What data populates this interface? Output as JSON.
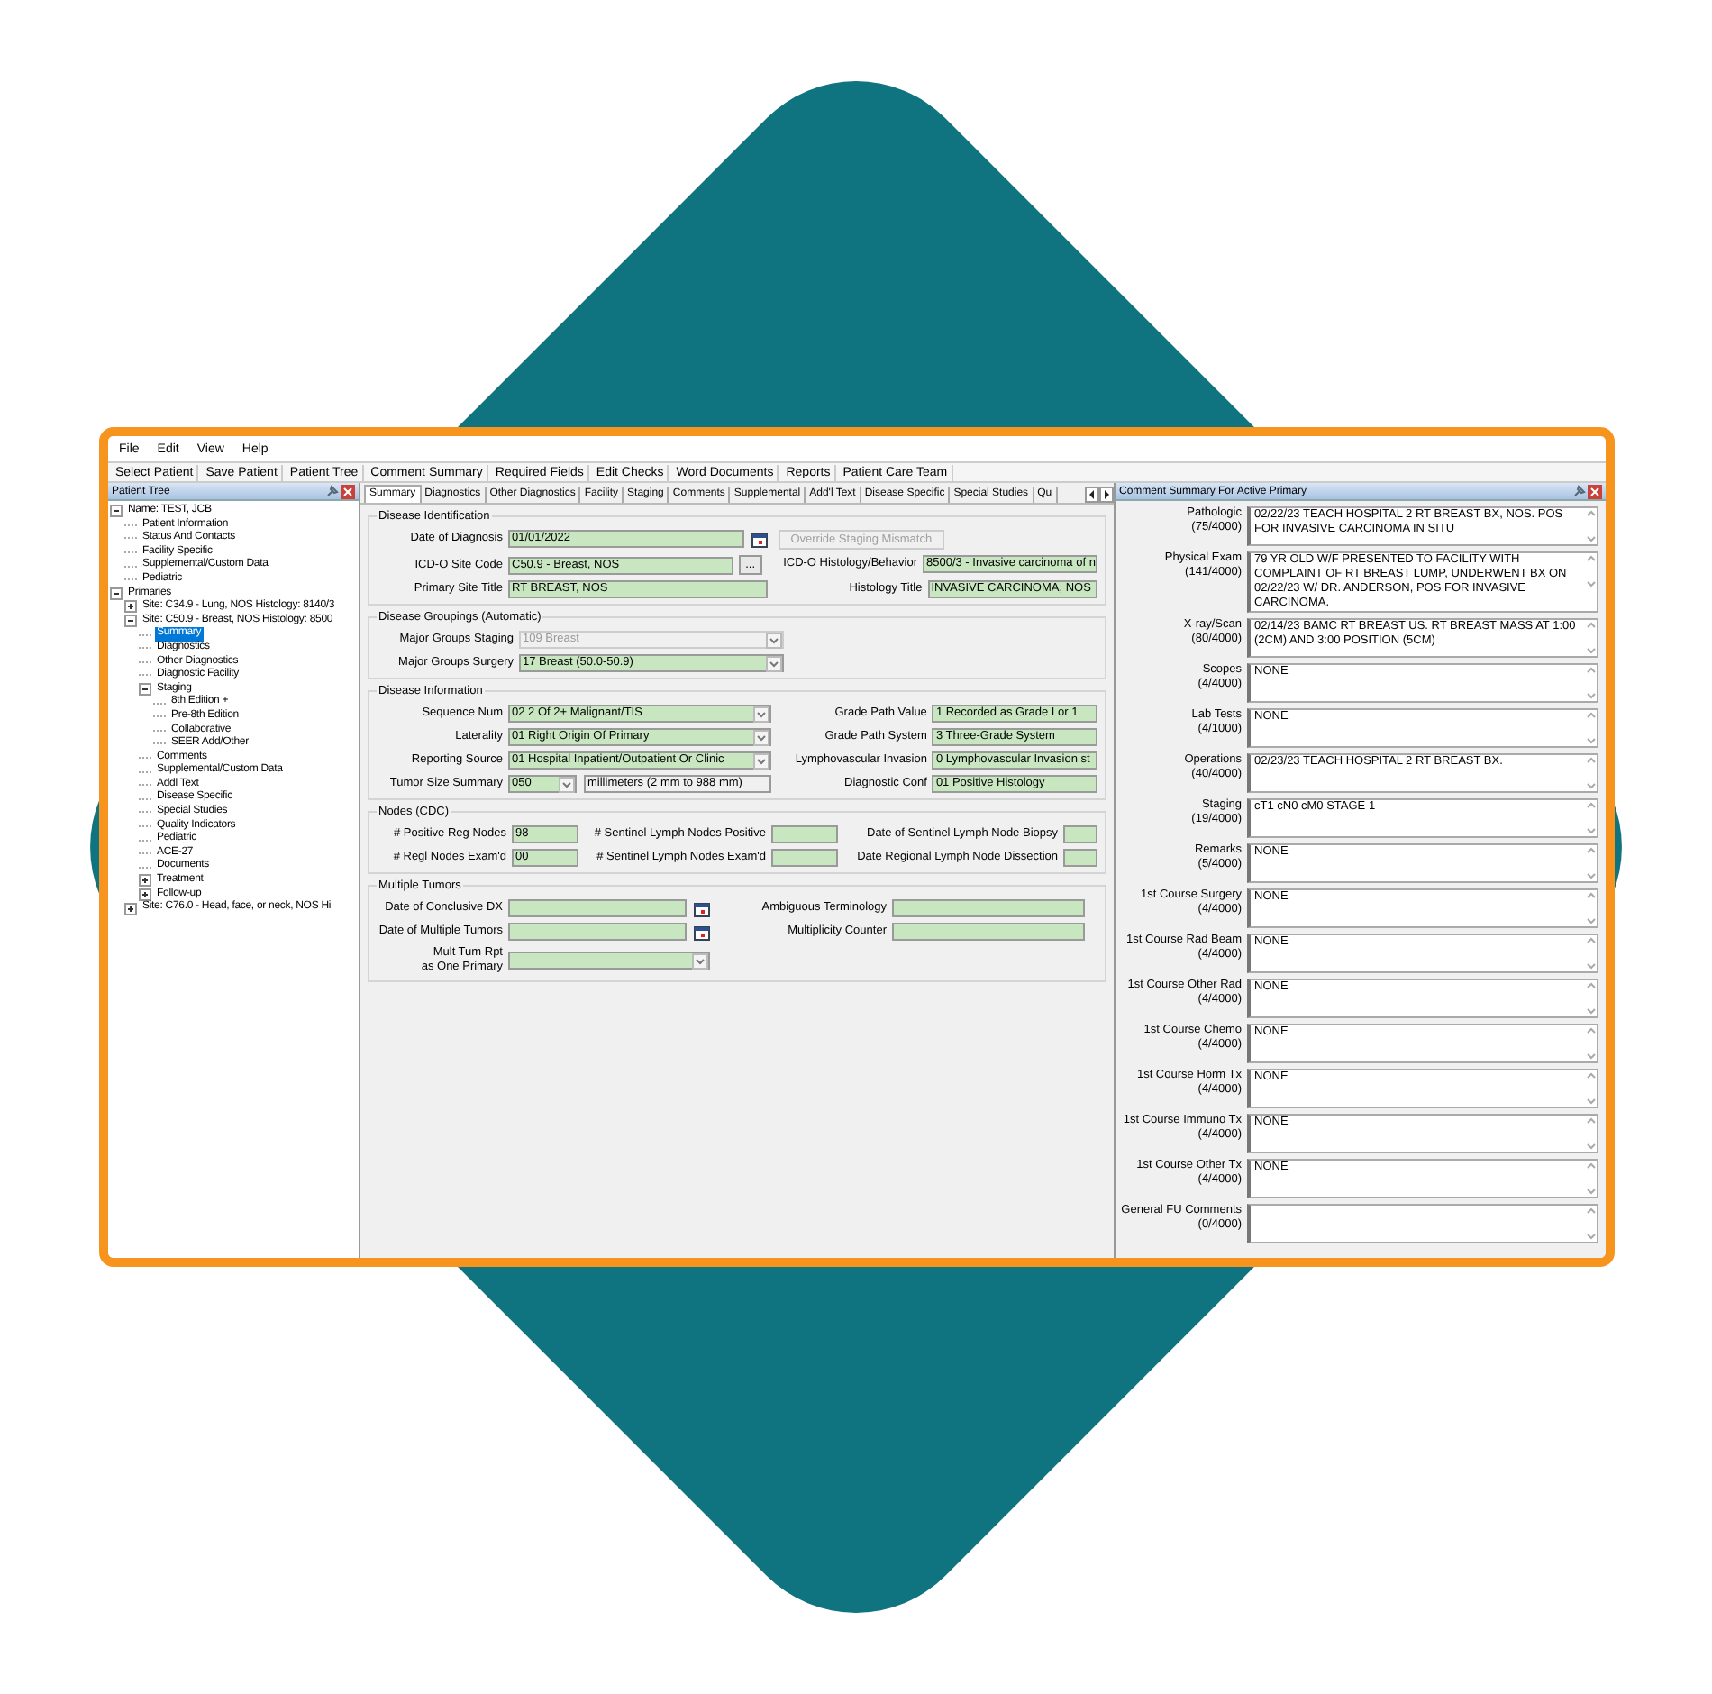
{
  "menu": [
    "File",
    "Edit",
    "View",
    "Help"
  ],
  "toolbar": [
    "Select Patient",
    "Save Patient",
    "Patient Tree",
    "Comment Summary",
    "Required Fields",
    "Edit Checks",
    "Word Documents",
    "Reports",
    "Patient Care Team"
  ],
  "tree": {
    "title": "Patient Tree",
    "nodes": [
      {
        "label": "Name: TEST, JCB",
        "kind": "branch",
        "expanded": true,
        "selected": false,
        "children": [
          {
            "label": "Patient Information",
            "kind": "leaf",
            "selected": false
          },
          {
            "label": "Status And Contacts",
            "kind": "leaf",
            "selected": false
          },
          {
            "label": "Facility Specific",
            "kind": "leaf",
            "selected": false
          },
          {
            "label": "Supplemental/Custom Data",
            "kind": "leaf",
            "selected": false
          },
          {
            "label": "Pediatric",
            "kind": "leaf",
            "selected": false
          }
        ]
      },
      {
        "label": "Primaries",
        "kind": "branch",
        "expanded": true,
        "selected": false,
        "children": [
          {
            "label": "Site: C34.9 - Lung, NOS Histology: 8140/3",
            "kind": "branch",
            "expanded": false,
            "selected": false
          },
          {
            "label": "Site: C50.9 - Breast, NOS Histology: 8500",
            "kind": "branch",
            "expanded": true,
            "selected": false,
            "children": [
              {
                "label": "Summary",
                "kind": "leaf",
                "selected": true
              },
              {
                "label": "Diagnostics",
                "kind": "leaf",
                "selected": false
              },
              {
                "label": "Other Diagnostics",
                "kind": "leaf",
                "selected": false
              },
              {
                "label": "Diagnostic Facility",
                "kind": "leaf",
                "selected": false
              },
              {
                "label": "Staging",
                "kind": "branch",
                "expanded": true,
                "selected": false,
                "children": [
                  {
                    "label": "8th Edition +",
                    "kind": "leaf",
                    "selected": false
                  },
                  {
                    "label": "Pre-8th Edition",
                    "kind": "leaf",
                    "selected": false
                  },
                  {
                    "label": "Collaborative",
                    "kind": "leaf",
                    "selected": false
                  },
                  {
                    "label": "SEER Add/Other",
                    "kind": "leaf",
                    "selected": false
                  }
                ]
              },
              {
                "label": "Comments",
                "kind": "leaf",
                "selected": false
              },
              {
                "label": "Supplemental/Custom Data",
                "kind": "leaf",
                "selected": false
              },
              {
                "label": "Addl Text",
                "kind": "leaf",
                "selected": false
              },
              {
                "label": "Disease Specific",
                "kind": "leaf",
                "selected": false
              },
              {
                "label": "Special Studies",
                "kind": "leaf",
                "selected": false
              },
              {
                "label": "Quality Indicators",
                "kind": "leaf",
                "selected": false
              },
              {
                "label": "Pediatric",
                "kind": "leaf",
                "selected": false
              },
              {
                "label": "ACE-27",
                "kind": "leaf",
                "selected": false
              },
              {
                "label": "Documents",
                "kind": "leaf",
                "selected": false
              },
              {
                "label": "Treatment",
                "kind": "branch",
                "expanded": false,
                "selected": false
              },
              {
                "label": "Follow-up",
                "kind": "branch",
                "expanded": false,
                "selected": false
              }
            ]
          },
          {
            "label": "Site: C76.0 - Head, face, or neck, NOS Hi",
            "kind": "branch",
            "expanded": false,
            "selected": false
          }
        ]
      }
    ]
  },
  "tabs": [
    {
      "label": "Summary",
      "selected": true
    },
    {
      "label": "Diagnostics",
      "selected": false
    },
    {
      "label": "Other Diagnostics",
      "selected": false
    },
    {
      "label": "Facility",
      "selected": false
    },
    {
      "label": "Staging",
      "selected": false
    },
    {
      "label": "Comments",
      "selected": false
    },
    {
      "label": "Supplemental",
      "selected": false
    },
    {
      "label": "Add'l Text",
      "selected": false
    },
    {
      "label": "Disease Specific",
      "selected": false
    },
    {
      "label": "Special Studies",
      "selected": false
    },
    {
      "label": "Qu",
      "selected": false
    }
  ],
  "sections": [
    {
      "kind": "identification",
      "title": "Disease Identification",
      "rows": [
        [
          {
            "label": "Date of Diagnosis",
            "controls": [
              {
                "kind": "date",
                "value": "01/01/2022"
              }
            ]
          },
          {
            "controls": [
              {
                "kind": "button",
                "value": "Override Staging Mismatch",
                "disabled": true
              }
            ]
          }
        ],
        [
          {
            "label": "ICD-O Site Code",
            "controls": [
              {
                "kind": "lookup",
                "value": "C50.9 - Breast, NOS",
                "button": "..."
              }
            ]
          },
          {
            "label": "ICD-O Histology/Behavior",
            "controls": [
              {
                "kind": "text",
                "value": "8500/3 - Invasive carcinoma of n"
              }
            ]
          }
        ],
        [
          {
            "label": "Primary Site Title",
            "controls": [
              {
                "kind": "text",
                "value": "RT BREAST, NOS"
              }
            ]
          },
          {
            "label": "Histology Title",
            "controls": [
              {
                "kind": "text",
                "value": "INVASIVE CARCINOMA, NOS"
              }
            ]
          }
        ]
      ]
    },
    {
      "kind": "groupings",
      "title": "Disease Groupings (Automatic)",
      "rows": [
        [
          {
            "label": "Major Groups Staging",
            "controls": [
              {
                "kind": "select",
                "value": "109 Breast",
                "disabled": true
              }
            ]
          }
        ],
        [
          {
            "label": "Major Groups Surgery",
            "controls": [
              {
                "kind": "select",
                "value": "17 Breast  (50.0-50.9)",
                "disabled": false
              }
            ]
          }
        ]
      ]
    },
    {
      "kind": "information",
      "title": "Disease Information",
      "rows": [
        [
          {
            "label": "Sequence Num",
            "controls": [
              {
                "kind": "select",
                "value": "02 2 Of 2+ Malignant/TIS",
                "disabled": false
              }
            ]
          },
          {
            "label": "Grade Path Value",
            "controls": [
              {
                "kind": "text",
                "value": "1 Recorded as Grade I or 1"
              }
            ]
          }
        ],
        [
          {
            "label": "Laterality",
            "controls": [
              {
                "kind": "select",
                "value": "01 Right Origin Of Primary",
                "disabled": false
              }
            ]
          },
          {
            "label": "Grade Path System",
            "controls": [
              {
                "kind": "text",
                "value": "3 Three-Grade System"
              }
            ]
          }
        ],
        [
          {
            "label": "Reporting Source",
            "controls": [
              {
                "kind": "select",
                "value": "01 Hospital Inpatient/Outpatient Or Clinic",
                "disabled": false
              }
            ]
          },
          {
            "label": "Lymphovascular Invasion",
            "controls": [
              {
                "kind": "text",
                "value": "0 Lymphovascular Invasion st"
              }
            ]
          }
        ],
        [
          {
            "label": "Tumor Size Summary",
            "controls": [
              {
                "kind": "short-select",
                "value": "050"
              },
              {
                "kind": "readonly",
                "value": "millimeters (2 mm to 988 mm)"
              }
            ]
          },
          {
            "label": "Diagnostic Conf",
            "controls": [
              {
                "kind": "text",
                "value": "01 Positive Histology"
              }
            ]
          }
        ]
      ]
    },
    {
      "kind": "nodes",
      "title": "Nodes (CDC)",
      "rows": [
        [
          {
            "label": "# Positive Reg Nodes",
            "controls": [
              {
                "kind": "text",
                "value": "98"
              }
            ]
          },
          {
            "label": "# Sentinel Lymph Nodes Positive",
            "controls": [
              {
                "kind": "text"
              }
            ]
          },
          {
            "label": "Date of Sentinel Lymph Node Biopsy",
            "controls": [
              {
                "kind": "text"
              }
            ]
          }
        ],
        [
          {
            "label": "# Regl Nodes Exam'd",
            "controls": [
              {
                "kind": "text",
                "value": "00"
              }
            ]
          },
          {
            "label": "# Sentinel Lymph Nodes Exam'd",
            "controls": [
              {
                "kind": "text"
              }
            ]
          },
          {
            "label": "Date Regional Lymph Node Dissection",
            "controls": [
              {
                "kind": "text"
              }
            ]
          }
        ]
      ]
    },
    {
      "kind": "multiple",
      "title": "Multiple Tumors",
      "rows": [
        [
          {
            "label": "Date of Conclusive DX",
            "controls": [
              {
                "kind": "date"
              }
            ]
          },
          {
            "label": "Ambiguous Terminology",
            "controls": [
              {
                "kind": "text"
              }
            ]
          }
        ],
        [
          {
            "label": "Date of Multiple Tumors",
            "controls": [
              {
                "kind": "date"
              }
            ]
          },
          {
            "label": "Multiplicity Counter",
            "controls": [
              {
                "kind": "text"
              }
            ]
          }
        ],
        [
          {
            "label": "Mult Tum Rpt\nas One Primary",
            "controls": [
              {
                "kind": "select",
                "disabled": false
              }
            ]
          }
        ]
      ]
    }
  ],
  "comments": {
    "title": "Comment Summary For Active Primary",
    "rows": [
      {
        "label": "Pathologic",
        "count": "(75/4000)",
        "value": "02/22/23 TEACH HOSPITAL 2 RT BREAST BX, NOS. POS FOR INVASIVE CARCINOMA IN SITU"
      },
      {
        "label": "Physical Exam",
        "count": "(141/4000)",
        "value": "79 YR OLD W/F PRESENTED TO FACILITY WITH COMPLAINT OF RT BREAST LUMP, UNDERWENT BX ON 02/22/23 W/ DR. ANDERSON, POS FOR INVASIVE CARCINOMA."
      },
      {
        "label": "X-ray/Scan",
        "count": "(80/4000)",
        "value": "02/14/23 BAMC RT BREAST US. RT BREAST MASS AT 1:00 (2CM) AND 3:00 POSITION (5CM)"
      },
      {
        "label": "Scopes",
        "count": "(4/4000)",
        "value": "NONE"
      },
      {
        "label": "Lab Tests",
        "count": "(4/1000)",
        "value": "NONE"
      },
      {
        "label": "Operations",
        "count": "(40/4000)",
        "value": "02/23/23 TEACH HOSPITAL 2 RT BREAST BX."
      },
      {
        "label": "Staging",
        "count": "(19/4000)",
        "value": "cT1 cN0 cM0 STAGE 1"
      },
      {
        "label": "Remarks",
        "count": "(5/4000)",
        "value": "NONE"
      },
      {
        "label": "1st Course Surgery",
        "count": "(4/4000)",
        "value": "NONE"
      },
      {
        "label": "1st Course Rad Beam",
        "count": "(4/4000)",
        "value": "NONE"
      },
      {
        "label": "1st Course Other Rad",
        "count": "(4/4000)",
        "value": "NONE"
      },
      {
        "label": "1st Course Chemo",
        "count": "(4/4000)",
        "value": "NONE"
      },
      {
        "label": "1st Course Horm Tx",
        "count": "(4/4000)",
        "value": "NONE"
      },
      {
        "label": "1st Course Immuno Tx",
        "count": "(4/4000)",
        "value": "NONE"
      },
      {
        "label": "1st Course Other Tx",
        "count": "(4/4000)",
        "value": "NONE"
      },
      {
        "label": "General FU Comments",
        "count": "(0/4000)"
      }
    ]
  }
}
